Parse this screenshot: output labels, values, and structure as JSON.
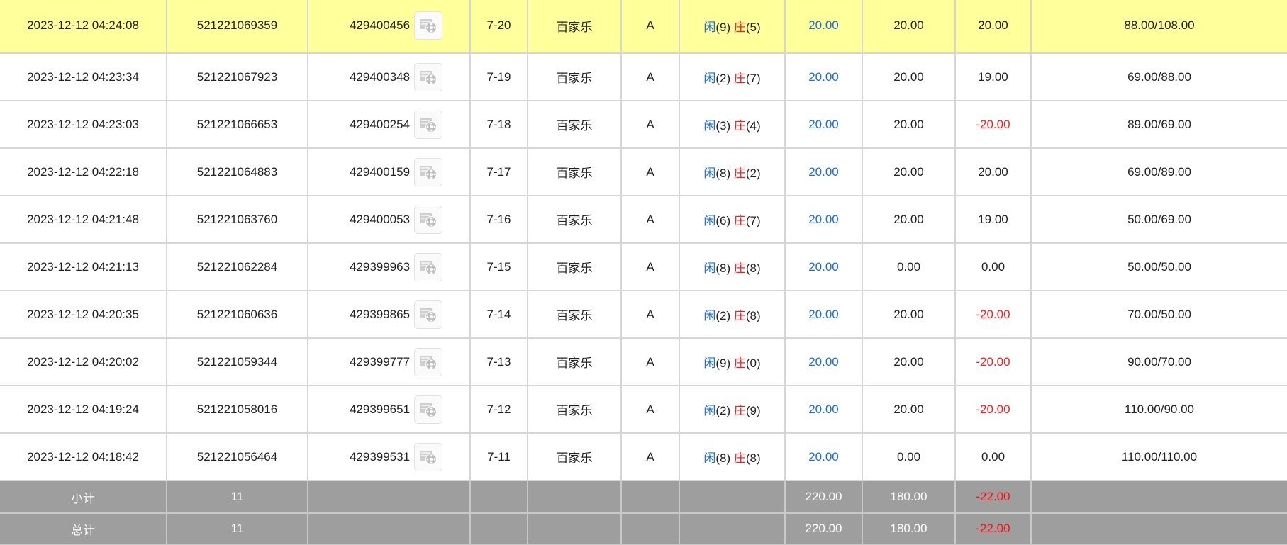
{
  "rows": [
    {
      "time": "2023-12-12 04:24:08",
      "order_no": "521221069359",
      "round_no": "429400456",
      "shoe": "7-20",
      "game": "百家乐",
      "table": "A",
      "player_label": "闲",
      "player_score": "(9)",
      "banker_label": "庄",
      "banker_score": "(5)",
      "bet": "20.00",
      "valid": "20.00",
      "payout": "20.00",
      "payout_negative": false,
      "balance": "88.00/108.00"
    },
    {
      "time": "2023-12-12 04:23:34",
      "order_no": "521221067923",
      "round_no": "429400348",
      "shoe": "7-19",
      "game": "百家乐",
      "table": "A",
      "player_label": "闲",
      "player_score": "(2)",
      "banker_label": "庄",
      "banker_score": "(7)",
      "bet": "20.00",
      "valid": "20.00",
      "payout": "19.00",
      "payout_negative": false,
      "balance": "69.00/88.00"
    },
    {
      "time": "2023-12-12 04:23:03",
      "order_no": "521221066653",
      "round_no": "429400254",
      "shoe": "7-18",
      "game": "百家乐",
      "table": "A",
      "player_label": "闲",
      "player_score": "(3)",
      "banker_label": "庄",
      "banker_score": "(4)",
      "bet": "20.00",
      "valid": "20.00",
      "payout": "-20.00",
      "payout_negative": true,
      "balance": "89.00/69.00"
    },
    {
      "time": "2023-12-12 04:22:18",
      "order_no": "521221064883",
      "round_no": "429400159",
      "shoe": "7-17",
      "game": "百家乐",
      "table": "A",
      "player_label": "闲",
      "player_score": "(8)",
      "banker_label": "庄",
      "banker_score": "(2)",
      "bet": "20.00",
      "valid": "20.00",
      "payout": "20.00",
      "payout_negative": false,
      "balance": "69.00/89.00"
    },
    {
      "time": "2023-12-12 04:21:48",
      "order_no": "521221063760",
      "round_no": "429400053",
      "shoe": "7-16",
      "game": "百家乐",
      "table": "A",
      "player_label": "闲",
      "player_score": "(6)",
      "banker_label": "庄",
      "banker_score": "(7)",
      "bet": "20.00",
      "valid": "20.00",
      "payout": "19.00",
      "payout_negative": false,
      "balance": "50.00/69.00"
    },
    {
      "time": "2023-12-12 04:21:13",
      "order_no": "521221062284",
      "round_no": "429399963",
      "shoe": "7-15",
      "game": "百家乐",
      "table": "A",
      "player_label": "闲",
      "player_score": "(8)",
      "banker_label": "庄",
      "banker_score": "(8)",
      "bet": "20.00",
      "valid": "0.00",
      "payout": "0.00",
      "payout_negative": false,
      "balance": "50.00/50.00"
    },
    {
      "time": "2023-12-12 04:20:35",
      "order_no": "521221060636",
      "round_no": "429399865",
      "shoe": "7-14",
      "game": "百家乐",
      "table": "A",
      "player_label": "闲",
      "player_score": "(2)",
      "banker_label": "庄",
      "banker_score": "(8)",
      "bet": "20.00",
      "valid": "20.00",
      "payout": "-20.00",
      "payout_negative": true,
      "balance": "70.00/50.00"
    },
    {
      "time": "2023-12-12 04:20:02",
      "order_no": "521221059344",
      "round_no": "429399777",
      "shoe": "7-13",
      "game": "百家乐",
      "table": "A",
      "player_label": "闲",
      "player_score": "(9)",
      "banker_label": "庄",
      "banker_score": "(0)",
      "bet": "20.00",
      "valid": "20.00",
      "payout": "-20.00",
      "payout_negative": true,
      "balance": "90.00/70.00"
    },
    {
      "time": "2023-12-12 04:19:24",
      "order_no": "521221058016",
      "round_no": "429399651",
      "shoe": "7-12",
      "game": "百家乐",
      "table": "A",
      "player_label": "闲",
      "player_score": "(2)",
      "banker_label": "庄",
      "banker_score": "(9)",
      "bet": "20.00",
      "valid": "20.00",
      "payout": "-20.00",
      "payout_negative": true,
      "balance": "110.00/90.00"
    },
    {
      "time": "2023-12-12 04:18:42",
      "order_no": "521221056464",
      "round_no": "429399531",
      "shoe": "7-11",
      "game": "百家乐",
      "table": "A",
      "player_label": "闲",
      "player_score": "(8)",
      "banker_label": "庄",
      "banker_score": "(8)",
      "bet": "20.00",
      "valid": "0.00",
      "payout": "0.00",
      "payout_negative": false,
      "balance": "110.00/110.00"
    }
  ],
  "subtotal": {
    "label": "小计",
    "count": "11",
    "bet": "220.00",
    "valid": "180.00",
    "payout": "-22.00"
  },
  "total": {
    "label": "总计",
    "count": "11",
    "bet": "220.00",
    "valid": "180.00",
    "payout": "-22.00"
  },
  "icons": {
    "replay": "video-replay-icon"
  },
  "colors": {
    "highlight_row": "#ffff9c",
    "summary_bg": "#9e9e9e",
    "player_blue": "#1a6fe0",
    "banker_red": "#ff1a1a",
    "negative_red": "#ff1a1a"
  }
}
